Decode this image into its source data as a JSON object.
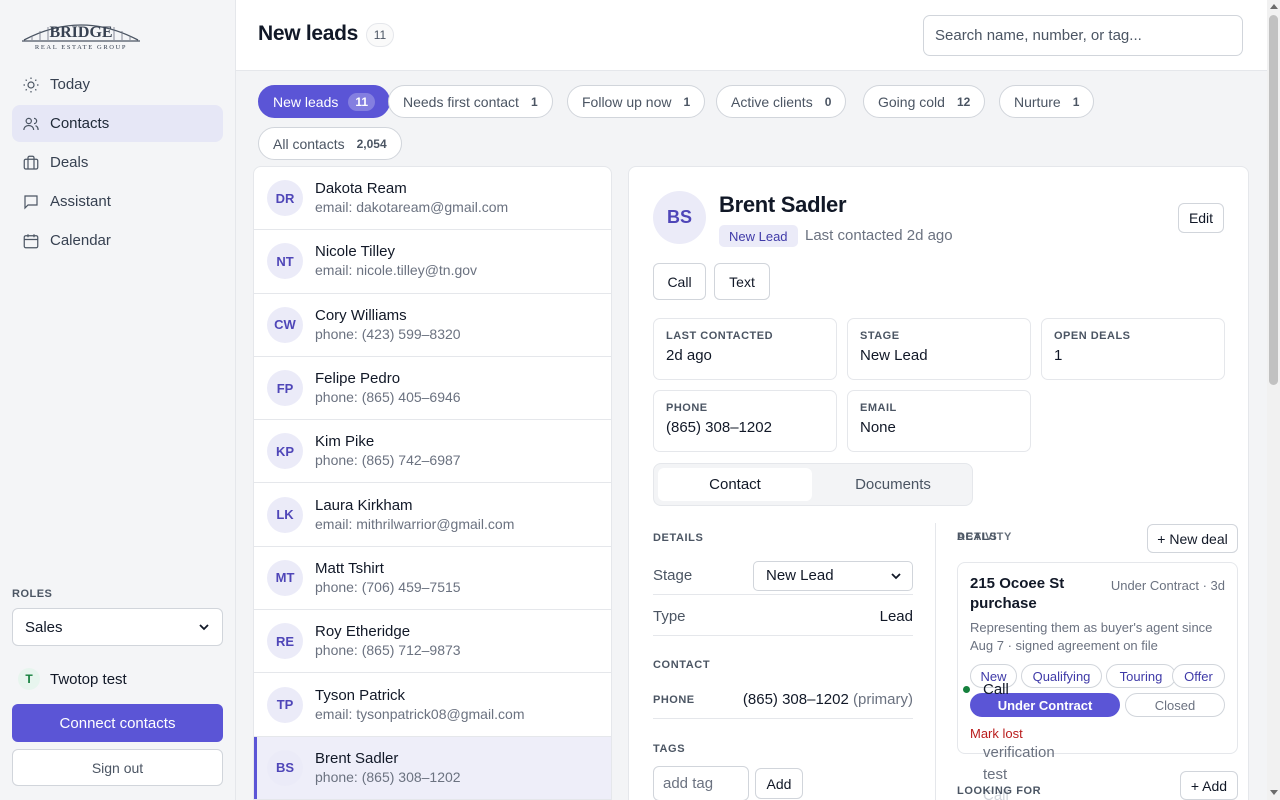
{
  "brand": {
    "name": "BRIDGE",
    "tagline": "REAL ESTATE GROUP"
  },
  "nav": [
    {
      "label": "Today",
      "icon": "sun-icon"
    },
    {
      "label": "Contacts",
      "icon": "users-icon",
      "active": true
    },
    {
      "label": "Deals",
      "icon": "briefcase-icon"
    },
    {
      "label": "Assistant",
      "icon": "chat-icon"
    },
    {
      "label": "Calendar",
      "icon": "calendar-icon"
    }
  ],
  "roles": {
    "label": "ROLES",
    "selected": "Sales"
  },
  "user": {
    "initial": "T",
    "name": "Twotop test"
  },
  "connect_label": "Connect contacts",
  "signout_label": "Sign out",
  "header": {
    "title": "New leads",
    "count": "11",
    "search_placeholder": "Search name, number, or tag..."
  },
  "filters": [
    {
      "label": "New leads",
      "count": "11",
      "active": true
    },
    {
      "label": "Needs first contact",
      "count": "1"
    },
    {
      "label": "Follow up now",
      "count": "1"
    },
    {
      "label": "Active clients",
      "count": "0"
    },
    {
      "label": "Going cold",
      "count": "12"
    },
    {
      "label": "Nurture",
      "count": "1"
    },
    {
      "label": "All contacts",
      "count": "2,054"
    }
  ],
  "contacts": [
    {
      "initials": "DR",
      "name": "Dakota Ream",
      "sub": "email: dakotaream@gmail.com"
    },
    {
      "initials": "NT",
      "name": "Nicole Tilley",
      "sub": "email: nicole.tilley@tn.gov"
    },
    {
      "initials": "CW",
      "name": "Cory Williams",
      "sub": "phone: (423) 599–8320"
    },
    {
      "initials": "FP",
      "name": "Felipe Pedro",
      "sub": "phone: (865) 405–6946"
    },
    {
      "initials": "KP",
      "name": "Kim Pike",
      "sub": "phone: (865) 742–6987"
    },
    {
      "initials": "LK",
      "name": "Laura Kirkham",
      "sub": "email: mithrilwarrior@gmail.com"
    },
    {
      "initials": "MT",
      "name": "Matt Tshirt",
      "sub": "phone: (706) 459–7515"
    },
    {
      "initials": "RE",
      "name": "Roy Etheridge",
      "sub": "phone: (865) 712–9873"
    },
    {
      "initials": "TP",
      "name": "Tyson Patrick",
      "sub": "email: tysonpatrick08@gmail.com"
    },
    {
      "initials": "BS",
      "name": "Brent Sadler",
      "sub": "phone: (865) 308–1202",
      "selected": true
    }
  ],
  "detail": {
    "initials": "BS",
    "name": "Brent Sadler",
    "badge": "New Lead",
    "last_contacted_text": "Last contacted 2d ago",
    "edit_label": "Edit",
    "call_label": "Call",
    "text_label": "Text",
    "info": {
      "last_contacted": {
        "label": "LAST CONTACTED",
        "value": "2d ago"
      },
      "stage": {
        "label": "STAGE",
        "value": "New Lead"
      },
      "open_deals": {
        "label": "OPEN DEALS",
        "value": "1"
      },
      "phone": {
        "label": "PHONE",
        "value": "(865) 308–1202"
      },
      "email": {
        "label": "EMAIL",
        "value": "None"
      }
    },
    "tabs": [
      "Contact",
      "Documents"
    ],
    "details_label": "DETAILS",
    "stage_row": {
      "key": "Stage",
      "value": "New Lead"
    },
    "type_row": {
      "key": "Type",
      "value": "Lead"
    },
    "contact_label": "CONTACT",
    "phone_row": {
      "key": "PHONE",
      "value": "(865) 308–1202",
      "note": "(primary)"
    },
    "tags_label": "TAGS",
    "tag_placeholder": "add tag",
    "tag_add_label": "Add",
    "deals_label": "DEALS",
    "activity_label": "ACTIVITY",
    "new_deal_label": "+ New deal",
    "deal": {
      "title": "215 Ocoee St purchase",
      "status": "Under Contract · 3d",
      "desc": "Representing them as buyer's agent since Aug 7 · signed agreement on file",
      "stages": [
        "New",
        "Qualifying",
        "Touring",
        "Offer",
        "Under Contract",
        "Closed"
      ],
      "mark_lost": "Mark lost"
    },
    "activity": {
      "call": "Call",
      "verification": "verification",
      "test": "test",
      "call2": "Call"
    },
    "looking_for_label": "LOOKING FOR",
    "add_label": "+ Add"
  }
}
